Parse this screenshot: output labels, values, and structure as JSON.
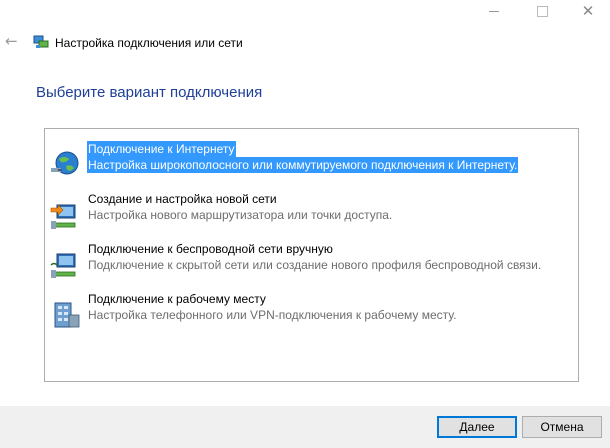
{
  "window": {
    "title": "Настройка подключения или сети"
  },
  "heading": "Выберите вариант подключения",
  "options": [
    {
      "title": "Подключение к Интернету",
      "description": "Настройка широкополосного или коммутируемого подключения к Интернету.",
      "icon": "globe-network-icon",
      "selected": true
    },
    {
      "title": "Создание и настройка новой сети",
      "description": "Настройка нового маршрутизатора или точки доступа.",
      "icon": "new-network-icon",
      "selected": false
    },
    {
      "title": "Подключение к беспроводной сети вручную",
      "description": "Подключение к скрытой сети или создание нового профиля беспроводной связи.",
      "icon": "wireless-network-icon",
      "selected": false
    },
    {
      "title": "Подключение к рабочему месту",
      "description": "Настройка телефонного или VPN-подключения к рабочему месту.",
      "icon": "workplace-vpn-icon",
      "selected": false
    }
  ],
  "buttons": {
    "next": "Далее",
    "cancel": "Отмена"
  },
  "colors": {
    "selection": "#3399ff",
    "heading": "#1f3f99",
    "default_button_border": "#0078d7"
  }
}
